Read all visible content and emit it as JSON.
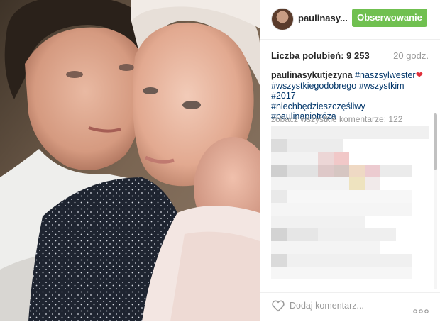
{
  "post": {
    "username": "paulinasy...",
    "follow_label": "Obserwowanie",
    "likes_text": "Liczba polubień: 9 253",
    "time_ago": "20 godz.",
    "caption": {
      "user": "paulinasykutjezyna",
      "tags": [
        "#naszsylwester",
        "#wszystkiegodobrego",
        "#wszystkim",
        "#2017",
        "#niechbędzieszczęśliwy",
        "#paulinapiotróża"
      ],
      "emoji": "❤"
    },
    "view_all_comments": "zobacz wszystkie komentarze: 122",
    "add_comment_placeholder": "Dodaj komentarz..."
  },
  "icons": {
    "avatar": "avatar",
    "like": "heart-outline-icon",
    "more": "more-options-icon"
  },
  "colors": {
    "follow_button": "#70c050",
    "hashtag": "#003569",
    "muted": "#999999"
  }
}
